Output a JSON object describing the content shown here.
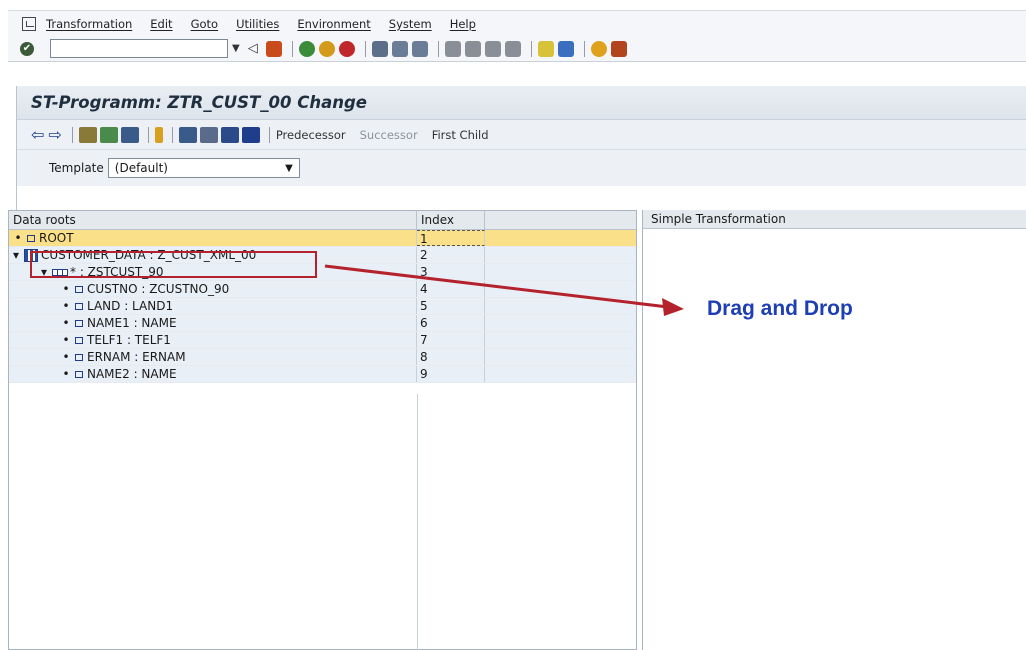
{
  "menu": [
    "Transformation",
    "Edit",
    "Goto",
    "Utilities",
    "Environment",
    "System",
    "Help"
  ],
  "title": "ST-Programm: ZTR_CUST_00 Change",
  "app_toolbar": {
    "predecessor": "Predecessor",
    "successor": "Successor",
    "first_child": "First Child"
  },
  "template": {
    "label": "Template",
    "value": "(Default)"
  },
  "tree": {
    "header_name": "Data roots",
    "header_index": "Index",
    "rows": [
      {
        "label": "ROOT",
        "index": "1"
      },
      {
        "label": "CUSTOMER_DATA : Z_CUST_XML_00",
        "index": "2"
      },
      {
        "label": "* : ZSTCUST_90",
        "index": "3"
      },
      {
        "label": "CUSTNO : ZCUSTNO_90",
        "index": "4"
      },
      {
        "label": "LAND : LAND1",
        "index": "5"
      },
      {
        "label": "NAME1 : NAME",
        "index": "6"
      },
      {
        "label": "TELF1 : TELF1",
        "index": "7"
      },
      {
        "label": "ERNAM : ERNAM",
        "index": "8"
      },
      {
        "label": "NAME2 : NAME",
        "index": "9"
      }
    ]
  },
  "right_panel": {
    "header": "Simple Transformation"
  },
  "annotation": "Drag and Drop",
  "colors": {
    "annotation": "#1e3fb3",
    "highlight": "#b4232d",
    "selected_row": "#fbe08a"
  }
}
